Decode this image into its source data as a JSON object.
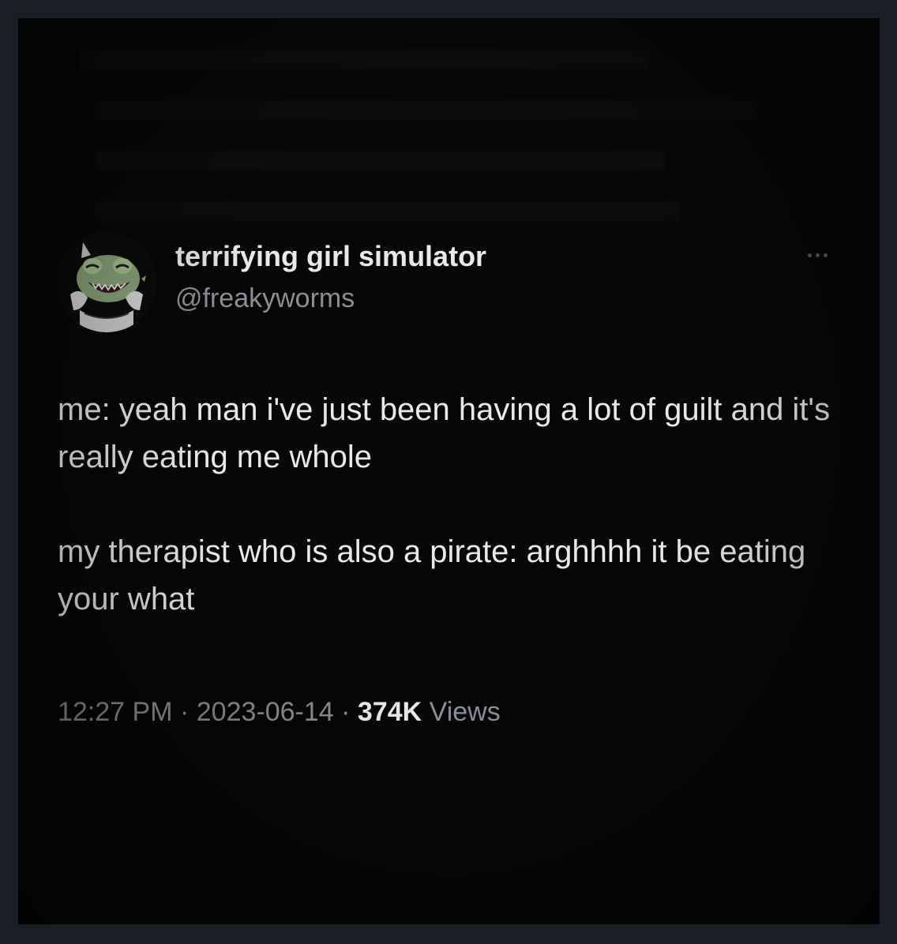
{
  "tweet": {
    "display_name": "terrifying girl simulator",
    "handle": "@freakyworms",
    "paragraphs": [
      "me: yeah man i've just been having a lot of guilt and it's really eating me whole",
      "my therapist who is also a pirate: arghhhh it be eating your what"
    ],
    "time": "12:27 PM",
    "separator": " · ",
    "date": "2023-06-14",
    "views_count": "374K",
    "views_label": "Views"
  },
  "icons": {
    "avatar": "avatar-frog-icon",
    "more": "more-options-icon"
  },
  "colors": {
    "background": "#070707",
    "frame": "#1a1e26",
    "primary_text": "#e7e9ea",
    "secondary_text": "#8b9096"
  }
}
